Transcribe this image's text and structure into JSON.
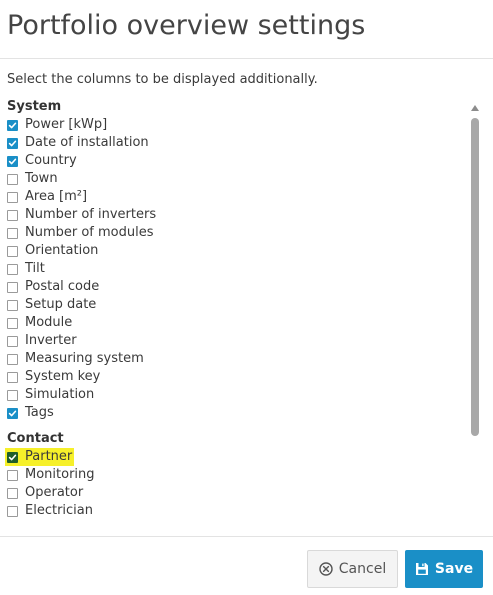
{
  "dialog": {
    "title": "Portfolio overview settings",
    "instruction": "Select the columns to be displayed additionally."
  },
  "sections": [
    {
      "heading": "System",
      "options": [
        {
          "label": "Power [kWp]",
          "checked": true
        },
        {
          "label": "Date of installation",
          "checked": true
        },
        {
          "label": "Country",
          "checked": true
        },
        {
          "label": "Town",
          "checked": false
        },
        {
          "label": "Area [m²]",
          "checked": false
        },
        {
          "label": "Number of inverters",
          "checked": false
        },
        {
          "label": "Number of modules",
          "checked": false
        },
        {
          "label": "Orientation",
          "checked": false
        },
        {
          "label": "Tilt",
          "checked": false
        },
        {
          "label": "Postal code",
          "checked": false
        },
        {
          "label": "Setup date",
          "checked": false
        },
        {
          "label": "Module",
          "checked": false
        },
        {
          "label": "Inverter",
          "checked": false
        },
        {
          "label": "Measuring system",
          "checked": false
        },
        {
          "label": "System key",
          "checked": false
        },
        {
          "label": "Simulation",
          "checked": false
        },
        {
          "label": "Tags",
          "checked": true
        }
      ]
    },
    {
      "heading": "Contact",
      "options": [
        {
          "label": "Partner",
          "checked": true,
          "highlighted": true
        },
        {
          "label": "Monitoring",
          "checked": false
        },
        {
          "label": "Operator",
          "checked": false
        },
        {
          "label": "Electrician",
          "checked": false
        }
      ]
    }
  ],
  "footer": {
    "cancel_label": "Cancel",
    "save_label": "Save"
  },
  "colors": {
    "accent": "#1a8fc7",
    "highlight": "#f6f02a",
    "checked_highlighted": "#1f5d2a"
  },
  "icons": {
    "cancel": "close-circle-icon",
    "save": "floppy-disk-icon",
    "scroll_up": "scroll-up-arrow-icon",
    "check": "checkmark-icon"
  }
}
